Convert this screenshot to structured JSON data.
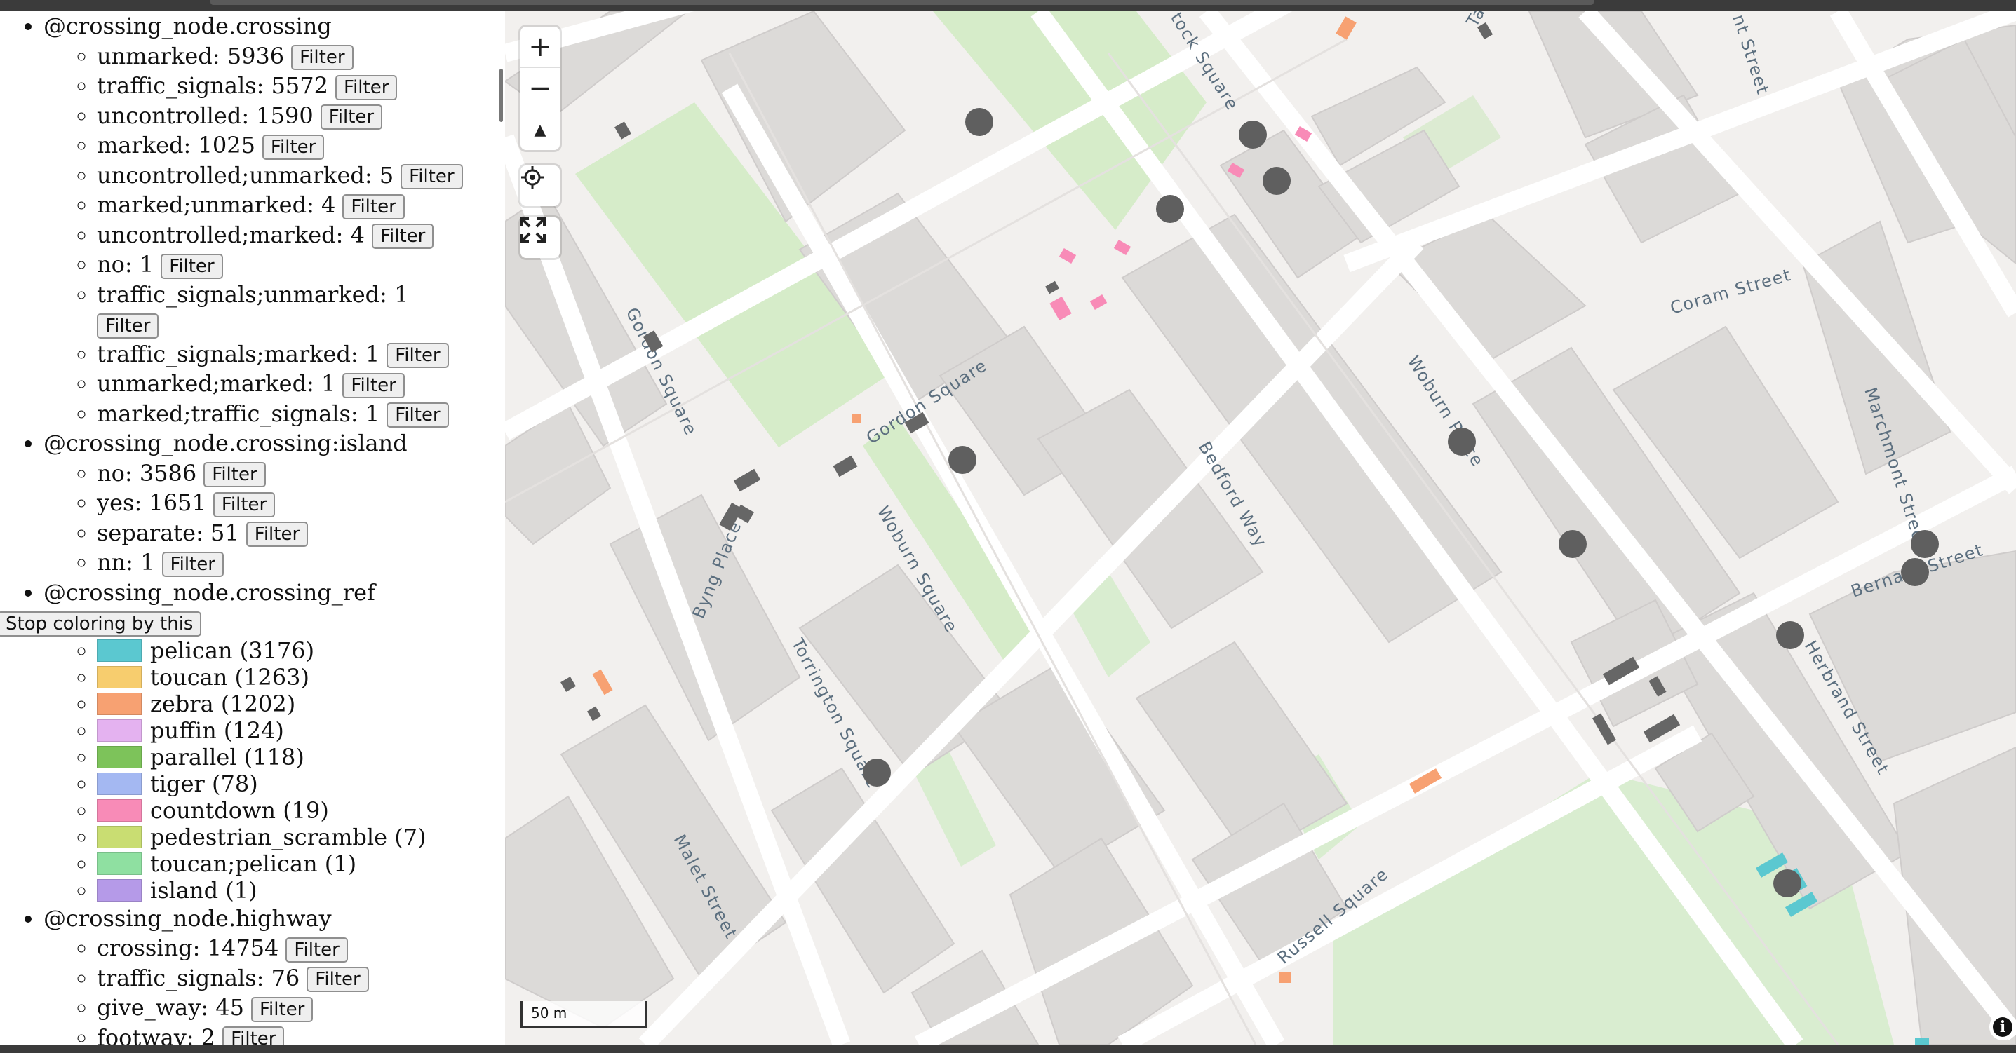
{
  "sidebar": {
    "filter_label": "Filter",
    "stop_label": "Stop coloring by this",
    "groups": {
      "crossing": {
        "title": "@crossing_node.crossing",
        "items": [
          {
            "label": "unmarked:",
            "count": "5936"
          },
          {
            "label": "traffic_signals:",
            "count": "5572"
          },
          {
            "label": "uncontrolled:",
            "count": "1590"
          },
          {
            "label": "marked:",
            "count": "1025"
          },
          {
            "label": "uncontrolled;unmarked:",
            "count": "5"
          },
          {
            "label": "marked;unmarked:",
            "count": "4"
          },
          {
            "label": "uncontrolled;marked:",
            "count": "4"
          },
          {
            "label": "no:",
            "count": "1"
          },
          {
            "label": "traffic_signals;unmarked:",
            "count": "1"
          },
          {
            "label": "traffic_signals;marked:",
            "count": "1"
          },
          {
            "label": "unmarked;marked:",
            "count": "1"
          },
          {
            "label": "marked;traffic_signals:",
            "count": "1"
          }
        ]
      },
      "island": {
        "title": "@crossing_node.crossing:island",
        "items": [
          {
            "label": "no:",
            "count": "3586"
          },
          {
            "label": "yes:",
            "count": "1651"
          },
          {
            "label": "separate:",
            "count": "51"
          },
          {
            "label": "nn:",
            "count": "1"
          }
        ]
      },
      "crossing_ref": {
        "title": "@crossing_node.crossing_ref",
        "legend": [
          {
            "label": "pelican (3176)",
            "color": "#5bc8d0"
          },
          {
            "label": "toucan (1263)",
            "color": "#f7cd6e"
          },
          {
            "label": "zebra (1202)",
            "color": "#f7a172"
          },
          {
            "label": "puffin (124)",
            "color": "#e4b2f0"
          },
          {
            "label": "parallel (118)",
            "color": "#7dc35a"
          },
          {
            "label": "tiger (78)",
            "color": "#a4b8f2"
          },
          {
            "label": "countdown (19)",
            "color": "#f88bb7"
          },
          {
            "label": "pedestrian_scramble (7)",
            "color": "#c9dd72"
          },
          {
            "label": "toucan;pelican (1)",
            "color": "#8fe0a1"
          },
          {
            "label": "island (1)",
            "color": "#b59ae8"
          }
        ]
      },
      "highway": {
        "title": "@crossing_node.highway",
        "items": [
          {
            "label": "crossing:",
            "count": "14754"
          },
          {
            "label": "traffic_signals:",
            "count": "76"
          },
          {
            "label": "give_way:",
            "count": "45"
          },
          {
            "label": "footway:",
            "count": "2"
          }
        ]
      }
    }
  },
  "map": {
    "controls": {
      "zoom_in": "+",
      "zoom_out": "−",
      "compass": "▲",
      "scale": "50 m",
      "info": "i"
    },
    "street_labels": {
      "gordon_square_1": "Gordon Square",
      "gordon_square_2": "Gordon Square",
      "tavistock_square": "tock Square",
      "byng_place": "Byng Place",
      "woburn_square": "Woburn Square",
      "torrington_square": "Torrington Square",
      "malet_street": "Malet Street",
      "bedford_way": "Bedford Way",
      "woburn_place": "Woburn Place",
      "coram_street": "Coram Street",
      "marchmont_street": "Marchmont Street",
      "bernard_street": "Bernard Street",
      "herbrand_street": "Herbrand Street",
      "russell_square": "Russell Square",
      "nt_street": "nt Street",
      "ta": "Ta"
    }
  }
}
